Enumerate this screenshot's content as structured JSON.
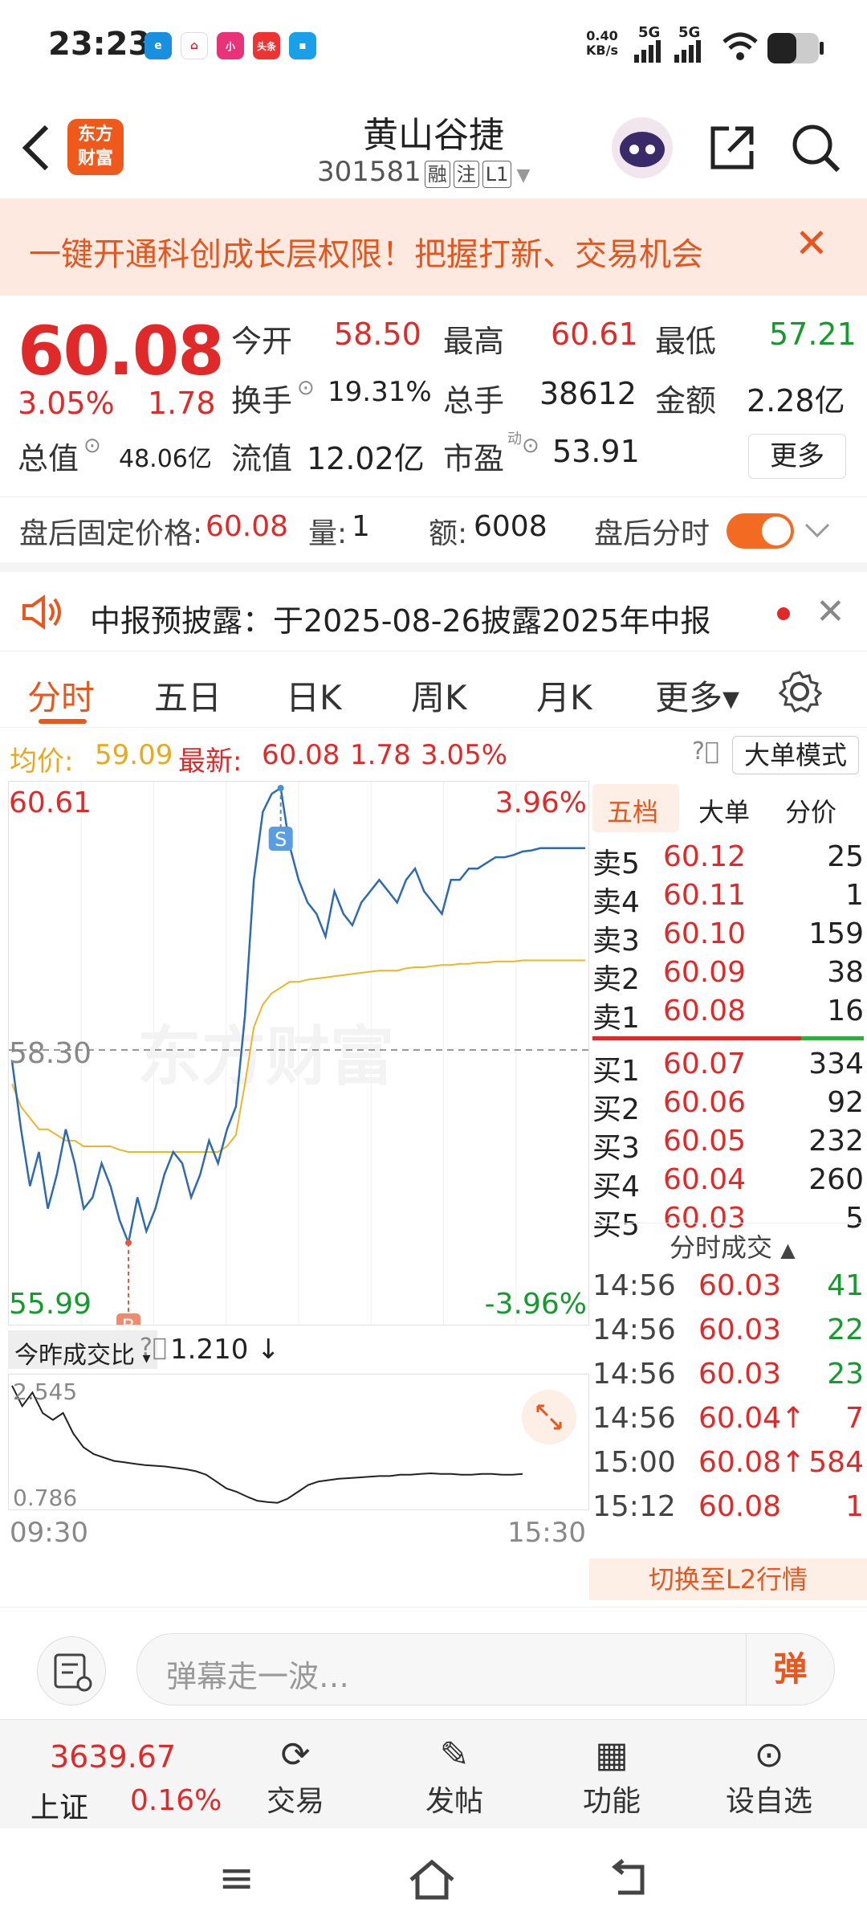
{
  "status_bar": {
    "time": "23:23",
    "net_speed": "0.40\nKB/s",
    "net_speed_top": "0.40",
    "net_speed_bottom": "KB/s",
    "sig1": "5G",
    "sig2": "5G",
    "app_icons": [
      "e",
      "⌂",
      "小",
      "头条",
      "▪"
    ]
  },
  "header": {
    "logo_line1": "东方",
    "logo_line2": "财富",
    "stock_name": "黄山谷捷",
    "stock_code": "301581",
    "tags": [
      "融",
      "注",
      "L1"
    ]
  },
  "banner": {
    "text": "一键开通科创成长层权限！把握打新、交易机会",
    "close": "✕"
  },
  "quote": {
    "price": "60.08",
    "change_pct": "3.05%",
    "change": "1.78",
    "open_label": "今开",
    "open": "58.50",
    "high_label": "最高",
    "high": "60.61",
    "low_label": "最低",
    "low": "57.21",
    "turnover_label": "换手",
    "turnover": "19.31%",
    "volume_label": "总手",
    "volume": "38612",
    "amount_label": "金额",
    "amount": "2.28亿",
    "mktcap_label": "总值",
    "mktcap": "48.06亿",
    "float_label": "流值",
    "float": "12.02亿",
    "pe_label": "市盈",
    "pe_sup": "动",
    "pe": "53.91",
    "more": "更多"
  },
  "after_hours": {
    "price_label": "盘后固定价格:",
    "price": "60.08",
    "vol_label": "量:",
    "vol": "1",
    "amt_label": "额:",
    "amt": "6008",
    "timeshare_label": "盘后分时"
  },
  "notice": {
    "text": "中报预披露：于2025-08-26披露2025年中报"
  },
  "tabs": [
    "分时",
    "五日",
    "日K",
    "周K",
    "月K",
    "更多▾"
  ],
  "chart_header": {
    "avg_label": "均价:",
    "avg": "59.09",
    "last_label": "最新:",
    "last": "60.08",
    "chg": "1.78",
    "chg_pct": "3.05%",
    "mode": "大单模式"
  },
  "chart_data": {
    "type": "line",
    "high_label": "60.61",
    "high_pct": "3.96%",
    "mid_label": "58.30",
    "low_label": "55.99",
    "low_pct": "-3.96%",
    "ylim": [
      55.99,
      60.61
    ],
    "prev_close": 58.3,
    "watermark": "东方财富",
    "buy_marker": "B",
    "sell_marker": "S",
    "price_series": [
      58.2,
      57.6,
      57.1,
      57.4,
      56.9,
      57.2,
      57.6,
      57.3,
      56.9,
      57.0,
      57.3,
      57.1,
      56.8,
      56.6,
      57.0,
      56.7,
      56.9,
      57.2,
      57.4,
      57.3,
      57.0,
      57.2,
      57.5,
      57.3,
      57.6,
      57.8,
      58.6,
      59.8,
      60.4,
      60.56,
      60.61,
      60.1,
      59.8,
      59.6,
      59.5,
      59.3,
      59.7,
      59.5,
      59.4,
      59.6,
      59.7,
      59.8,
      59.7,
      59.6,
      59.8,
      59.9,
      59.7,
      59.6,
      59.5,
      59.8,
      59.8,
      59.9,
      59.9,
      59.95,
      60.0,
      60.0,
      60.02,
      60.05,
      60.06,
      60.08,
      60.08,
      60.08,
      60.08,
      60.08,
      60.08
    ],
    "avg_series": [
      58.0,
      57.8,
      57.7,
      57.6,
      57.6,
      57.55,
      57.5,
      57.5,
      57.45,
      57.45,
      57.45,
      57.45,
      57.42,
      57.4,
      57.4,
      57.4,
      57.4,
      57.4,
      57.4,
      57.4,
      57.4,
      57.4,
      57.4,
      57.4,
      57.45,
      57.55,
      58.0,
      58.5,
      58.7,
      58.8,
      58.85,
      58.9,
      58.9,
      58.92,
      58.93,
      58.94,
      58.95,
      58.96,
      58.97,
      58.98,
      58.99,
      59.0,
      59.0,
      59.0,
      59.02,
      59.03,
      59.03,
      59.04,
      59.05,
      59.05,
      59.06,
      59.06,
      59.07,
      59.07,
      59.08,
      59.08,
      59.08,
      59.09,
      59.09,
      59.09,
      59.09,
      59.09,
      59.09,
      59.09,
      59.09
    ]
  },
  "volume_chart": {
    "selector": "今昨成交比",
    "value": "1.210 ↓",
    "top": "2.545",
    "bottom": "0.786",
    "time_start": "09:30",
    "time_end": "15:30",
    "ratio_series": [
      2.5,
      2.2,
      2.4,
      2.1,
      2.0,
      2.1,
      1.8,
      1.6,
      1.5,
      1.45,
      1.4,
      1.38,
      1.36,
      1.34,
      1.33,
      1.32,
      1.3,
      1.28,
      1.25,
      1.2,
      1.1,
      1.0,
      0.95,
      0.88,
      0.82,
      0.8,
      0.79,
      0.85,
      0.95,
      1.05,
      1.1,
      1.12,
      1.14,
      1.15,
      1.16,
      1.17,
      1.18,
      1.18,
      1.2,
      1.2,
      1.21,
      1.22,
      1.21,
      1.21,
      1.2,
      1.2,
      1.21,
      1.21,
      1.2,
      1.2,
      1.21
    ]
  },
  "order_book": {
    "tabs": [
      "五档",
      "大单",
      "分价"
    ],
    "asks": [
      {
        "label": "卖5",
        "price": "60.12",
        "vol": "25"
      },
      {
        "label": "卖4",
        "price": "60.11",
        "vol": "1"
      },
      {
        "label": "卖3",
        "price": "60.10",
        "vol": "159"
      },
      {
        "label": "卖2",
        "price": "60.09",
        "vol": "38"
      },
      {
        "label": "卖1",
        "price": "60.08",
        "vol": "16"
      }
    ],
    "bids": [
      {
        "label": "买1",
        "price": "60.07",
        "vol": "334"
      },
      {
        "label": "买2",
        "price": "60.06",
        "vol": "92"
      },
      {
        "label": "买3",
        "price": "60.05",
        "vol": "232"
      },
      {
        "label": "买4",
        "price": "60.04",
        "vol": "260"
      },
      {
        "label": "买5",
        "price": "60.03",
        "vol": "5"
      }
    ],
    "trades_title": "分时成交",
    "trades": [
      {
        "time": "14:56",
        "price": "60.03",
        "vol": "41"
      },
      {
        "time": "14:56",
        "price": "60.03",
        "vol": "22"
      },
      {
        "time": "14:56",
        "price": "60.03",
        "vol": "23"
      },
      {
        "time": "14:56",
        "price": "60.04↑",
        "vol": "7"
      },
      {
        "time": "15:00",
        "price": "60.08↑",
        "vol": "584"
      },
      {
        "time": "15:12",
        "price": "60.08",
        "vol": "1"
      }
    ],
    "switch_l2": "切换至L2行情"
  },
  "danmu": {
    "placeholder": "弹幕走一波…",
    "send": "弹"
  },
  "bottom_nav": {
    "index_value": "3639.67",
    "index_name": "上证",
    "index_pct": "0.16%",
    "items": [
      "交易",
      "发帖",
      "功能",
      "设自选"
    ]
  }
}
